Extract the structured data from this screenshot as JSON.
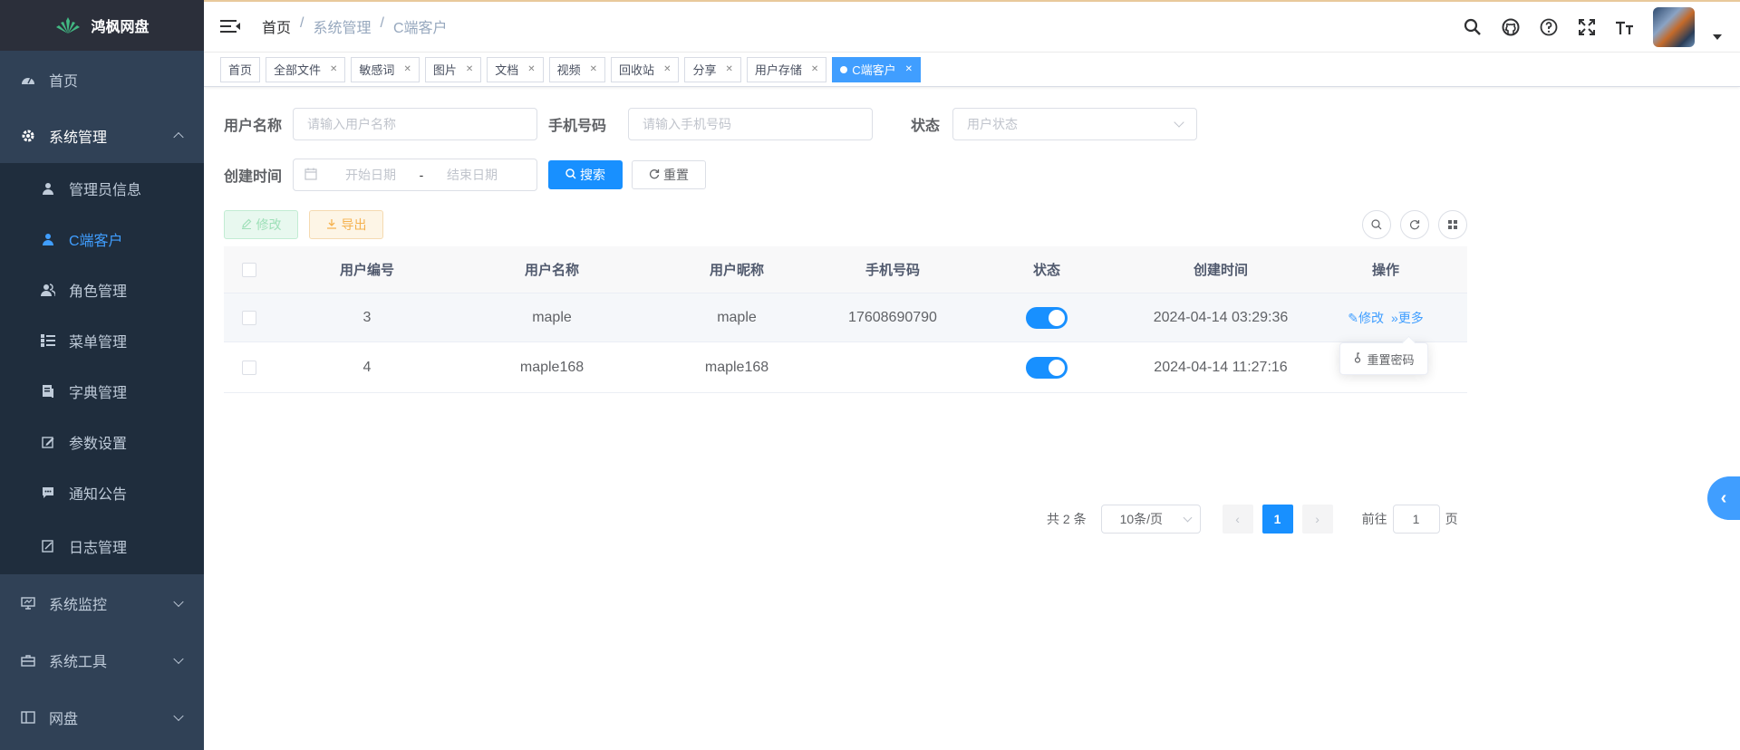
{
  "app": {
    "title": "鸿枫网盘"
  },
  "sidebar": {
    "home": "首页",
    "system": "系统管理",
    "sub": [
      {
        "label": "管理员信息",
        "icon": "user-icon"
      },
      {
        "label": "C端客户",
        "icon": "user-icon"
      },
      {
        "label": "角色管理",
        "icon": "peoples-icon"
      },
      {
        "label": "菜单管理",
        "icon": "tree-table-icon"
      },
      {
        "label": "字典管理",
        "icon": "dict-icon"
      },
      {
        "label": "参数设置",
        "icon": "edit-icon"
      },
      {
        "label": "通知公告",
        "icon": "message-icon"
      },
      {
        "label": "日志管理",
        "icon": "log-icon"
      }
    ],
    "monitor": "系统监控",
    "tools": "系统工具",
    "disk": "网盘"
  },
  "breadcrumb": [
    "首页",
    "/",
    "系统管理",
    "/",
    "C端客户"
  ],
  "tags": [
    "首页",
    "全部文件",
    "敏感词",
    "图片",
    "文档",
    "视频",
    "回收站",
    "分享",
    "用户存储",
    "C端客户"
  ],
  "search": {
    "username_label": "用户名称",
    "username_placeholder": "请输入用户名称",
    "phone_label": "手机号码",
    "phone_placeholder": "请输入手机号码",
    "status_label": "状态",
    "status_placeholder": "用户状态",
    "created_label": "创建时间",
    "start_placeholder": "开始日期",
    "range_sep": "-",
    "end_placeholder": "结束日期",
    "search_btn": "搜索",
    "reset_btn": "重置"
  },
  "toolbar": {
    "edit": "修改",
    "export": "导出"
  },
  "table": {
    "headers": [
      "用户编号",
      "用户名称",
      "用户昵称",
      "手机号码",
      "状态",
      "创建时间",
      "操作"
    ],
    "rows": [
      {
        "id": "3",
        "name": "maple",
        "nick": "maple",
        "phone": "17608690790",
        "status": true,
        "created": "2024-04-14 03:29:36"
      },
      {
        "id": "4",
        "name": "maple168",
        "nick": "maple168",
        "phone": "",
        "status": true,
        "created": "2024-04-14 11:27:16"
      }
    ],
    "op_edit": "修改",
    "op_more": "更多",
    "popover_reset": "重置密码"
  },
  "pagination": {
    "total_text": "共 2 条",
    "page_size": "10条/页",
    "current": "1",
    "goto_label": "前往",
    "goto_value": "1",
    "page_suffix": "页"
  },
  "colors": {
    "sidebar_bg": "#304156",
    "primary": "#1890ff",
    "active_text": "#409eff"
  }
}
